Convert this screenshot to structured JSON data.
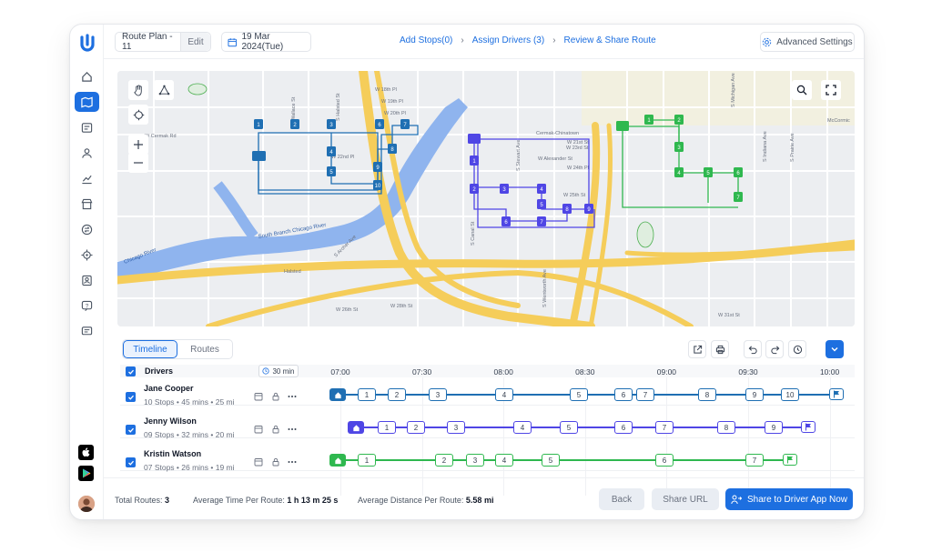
{
  "header": {
    "plan_name": "Route Plan - 11",
    "edit_label": "Edit",
    "date": "19 Mar 2024(Tue)",
    "steps": [
      "Add Stops(0)",
      "Assign Drivers (3)",
      "Review & Share Route"
    ],
    "advanced_settings": "Advanced Settings"
  },
  "sidebar": {
    "items": [
      "home-icon",
      "map-icon",
      "list-icon",
      "users-icon",
      "chart-icon",
      "store-icon",
      "swap-icon",
      "target-icon",
      "contacts-icon",
      "help-icon",
      "message-icon"
    ],
    "active": "map-icon"
  },
  "map": {
    "labels": [
      "W 22nd Pl",
      "W 23rd St",
      "W Cermak Rd",
      "Cermak-Chinatown",
      "W 24th Pl",
      "W 25th St",
      "S Archer Ave",
      "W 26th St",
      "W 28th St",
      "Halsted",
      "South Branch Chicago River",
      "Chicago River",
      "McCormic",
      "S Canal St",
      "W 31st St",
      "S Wentworth Ave",
      "S Halsted St",
      "S Wallace St",
      "S Stewart Ave",
      "S Michigan Ave",
      "S Indiana Ave",
      "S Prairie Ave",
      "W Alexander St",
      "W 21st St",
      "W 18th Pl",
      "W 19th Pl",
      "W 20th Pl"
    ]
  },
  "tabs": {
    "timeline": "Timeline",
    "routes": "Routes"
  },
  "timeline": {
    "header_label": "Drivers",
    "interval": "30 min",
    "times": [
      "07:00",
      "07:30",
      "08:00",
      "08:30",
      "09:00",
      "09:30",
      "10:00"
    ],
    "drivers": [
      {
        "name": "Jane Cooper",
        "stats": "10 Stops  •  45 mins  •  25 mi",
        "color": "#1f6fb3",
        "stops": [
          "1",
          "2",
          "3",
          "4",
          "5",
          "6",
          "7",
          "8",
          "9",
          "10"
        ]
      },
      {
        "name": "Jenny Wilson",
        "stats": "09 Stops  •  32 mins  •  20 mi",
        "color": "#4f46e5",
        "stops": [
          "1",
          "2",
          "3",
          "4",
          "5",
          "6",
          "7",
          "8",
          "9"
        ]
      },
      {
        "name": "Kristin Watson",
        "stats": "07 Stops  •  26 mins  •  19 mi",
        "color": "#2fb84f",
        "stops": [
          "1",
          "2",
          "3",
          "4",
          "5",
          "6",
          "7"
        ]
      }
    ]
  },
  "footer": {
    "total_routes_label": "Total Routes:",
    "total_routes": "3",
    "avg_time_label": "Average Time Per Route:",
    "avg_time": "1 h 13 m 25 s",
    "avg_dist_label": "Average Distance Per Route:",
    "avg_dist": "5.58 mi",
    "back": "Back",
    "share_url": "Share URL",
    "share_app": "Share to Driver App Now"
  },
  "colors": {
    "accent": "#1d6fe0",
    "route_blue": "#1f6fb3",
    "route_purple": "#4f46e5",
    "route_green": "#2fb84f",
    "river": "#8fb4ee",
    "highway": "#f5cd5a"
  }
}
